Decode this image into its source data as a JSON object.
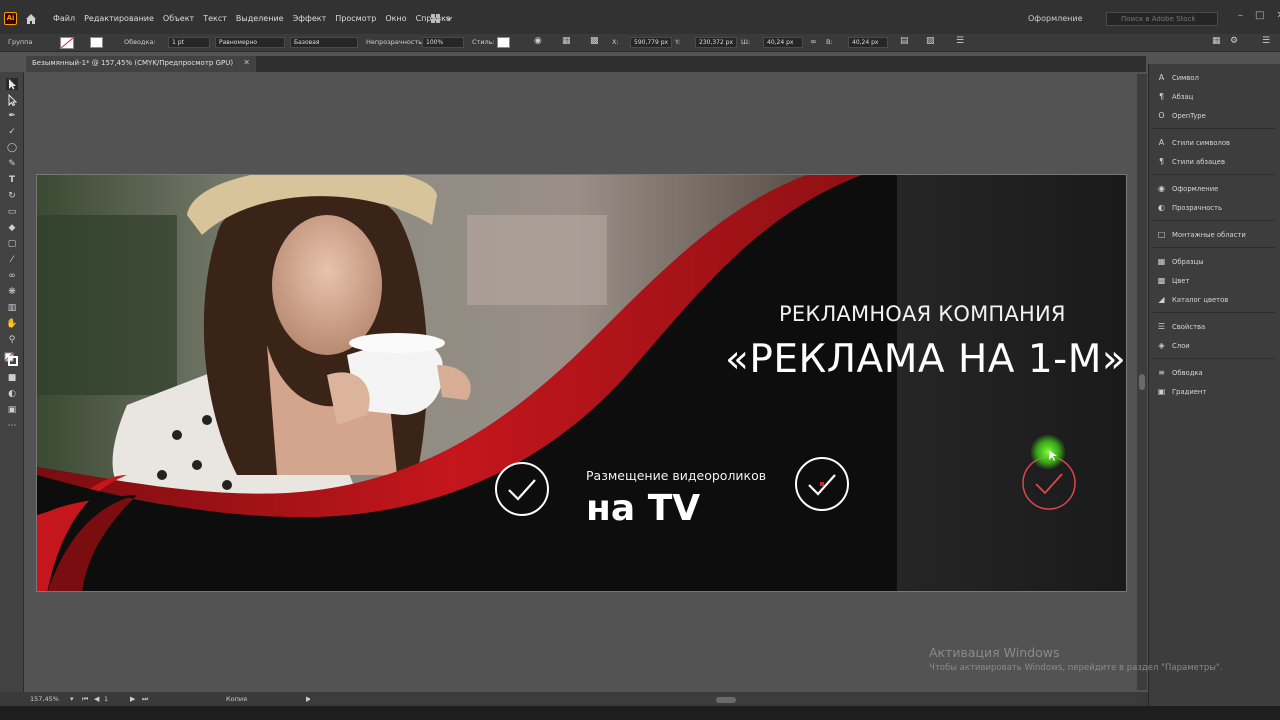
{
  "menubar": {
    "logo_text": "Ai",
    "items": [
      "Файл",
      "Редактирование",
      "Объект",
      "Текст",
      "Выделение",
      "Эффект",
      "Просмотр",
      "Окно",
      "Справка"
    ],
    "workspace": "Оформление",
    "stock_placeholder": "Поиск в Adobe Stock"
  },
  "controlbar": {
    "selection": "Группа",
    "stroke_label": "Обводка:",
    "stroke_value": "1 pt",
    "profile_label": "Равномерно",
    "brush_label": "Базовая",
    "opacity_label": "Непрозрачность:",
    "opacity_value": "100%",
    "style_label": "Стиль:",
    "x_label": "X:",
    "x_value": "590,779 px",
    "y_label": "Y:",
    "y_value": "230,372 px",
    "w_label": "Ш:",
    "w_value": "40,24 px",
    "h_label": "В:",
    "h_value": "40,24 px"
  },
  "document": {
    "tab_title": "Безымянный-1* @ 157,45% (CMYK/Предпросмотр GPU)"
  },
  "banner": {
    "headline1": "РЕКЛАМНОАЯ КОМПАНИЯ",
    "headline2": "«РЕКЛАМА НА 1-М»",
    "sub1": "Размещение видеороликов",
    "sub2": "на TV"
  },
  "panels": [
    {
      "icon": "character-icon",
      "label": "Символ"
    },
    {
      "icon": "paragraph-icon",
      "label": "Абзац"
    },
    {
      "icon": "opentype-icon",
      "label": "OpenType"
    },
    {
      "icon": "character-styles-icon",
      "label": "Стили символов"
    },
    {
      "icon": "paragraph-styles-icon",
      "label": "Стили абзацев"
    },
    {
      "icon": "appearance-icon",
      "label": "Оформление"
    },
    {
      "icon": "transparency-icon",
      "label": "Прозрачность"
    },
    {
      "icon": "artboards-icon",
      "label": "Монтажные области"
    },
    {
      "icon": "swatches-icon",
      "label": "Образцы"
    },
    {
      "icon": "color-icon",
      "label": "Цвет"
    },
    {
      "icon": "color-guide-icon",
      "label": "Каталог цветов"
    },
    {
      "icon": "properties-icon",
      "label": "Свойства"
    },
    {
      "icon": "layers-icon",
      "label": "Слои"
    },
    {
      "icon": "stroke-icon",
      "label": "Обводка"
    },
    {
      "icon": "gradient-icon",
      "label": "Градиент"
    }
  ],
  "statusbar": {
    "zoom": "157,45%",
    "artboard_num": "1",
    "status_text": "Копия"
  },
  "activation": {
    "title": "Активация Windows",
    "text": "Чтобы активировать Windows, перейдите в раздел \"Параметры\"."
  },
  "colors": {
    "accent_red": "#c4161c",
    "chrome_dark": "#323232",
    "panel_bg": "#3d3d3d"
  }
}
